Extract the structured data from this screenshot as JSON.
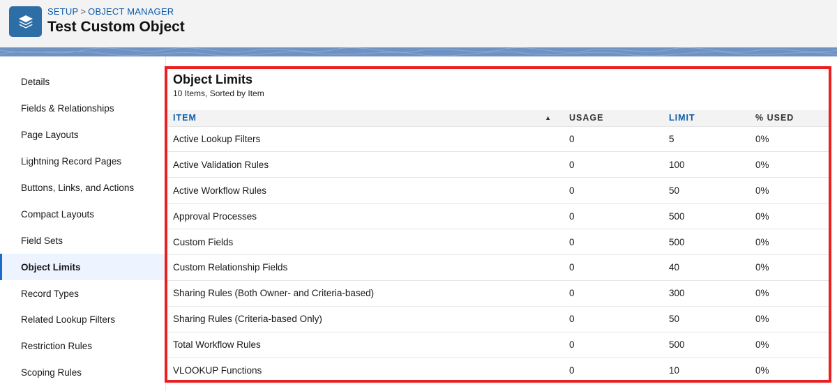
{
  "header": {
    "breadcrumb": [
      "SETUP",
      "OBJECT MANAGER"
    ],
    "breadcrumb_sep": ">",
    "title": "Test Custom Object",
    "icon": "stacked-layers-icon"
  },
  "sidebar": {
    "items": [
      {
        "label": "Details"
      },
      {
        "label": "Fields & Relationships"
      },
      {
        "label": "Page Layouts"
      },
      {
        "label": "Lightning Record Pages"
      },
      {
        "label": "Buttons, Links, and Actions"
      },
      {
        "label": "Compact Layouts"
      },
      {
        "label": "Field Sets"
      },
      {
        "label": "Object Limits",
        "active": true
      },
      {
        "label": "Record Types"
      },
      {
        "label": "Related Lookup Filters"
      },
      {
        "label": "Restriction Rules"
      },
      {
        "label": "Scoping Rules"
      }
    ]
  },
  "panel": {
    "title": "Object Limits",
    "subtitle": "10 Items, Sorted by Item",
    "columns": [
      "ITEM",
      "USAGE",
      "LIMIT",
      "% USED"
    ],
    "sort_icon": "sort-ascending-icon",
    "rows": [
      {
        "item": "Active Lookup Filters",
        "usage": "0",
        "limit": "5",
        "used": "0%"
      },
      {
        "item": "Active Validation Rules",
        "usage": "0",
        "limit": "100",
        "used": "0%"
      },
      {
        "item": "Active Workflow Rules",
        "usage": "0",
        "limit": "50",
        "used": "0%"
      },
      {
        "item": "Approval Processes",
        "usage": "0",
        "limit": "500",
        "used": "0%"
      },
      {
        "item": "Custom Fields",
        "usage": "0",
        "limit": "500",
        "used": "0%"
      },
      {
        "item": "Custom Relationship Fields",
        "usage": "0",
        "limit": "40",
        "used": "0%"
      },
      {
        "item": "Sharing Rules (Both Owner- and Criteria-based)",
        "usage": "0",
        "limit": "300",
        "used": "0%"
      },
      {
        "item": "Sharing Rules (Criteria-based Only)",
        "usage": "0",
        "limit": "50",
        "used": "0%"
      },
      {
        "item": "Total Workflow Rules",
        "usage": "0",
        "limit": "500",
        "used": "0%"
      },
      {
        "item": "VLOOKUP Functions",
        "usage": "0",
        "limit": "10",
        "used": "0%"
      }
    ]
  },
  "colors": {
    "accent": "#0b5cab",
    "icon_bg": "#2e6ea6",
    "highlight_border": "#ea1f1f",
    "band": "#6f92c4"
  }
}
